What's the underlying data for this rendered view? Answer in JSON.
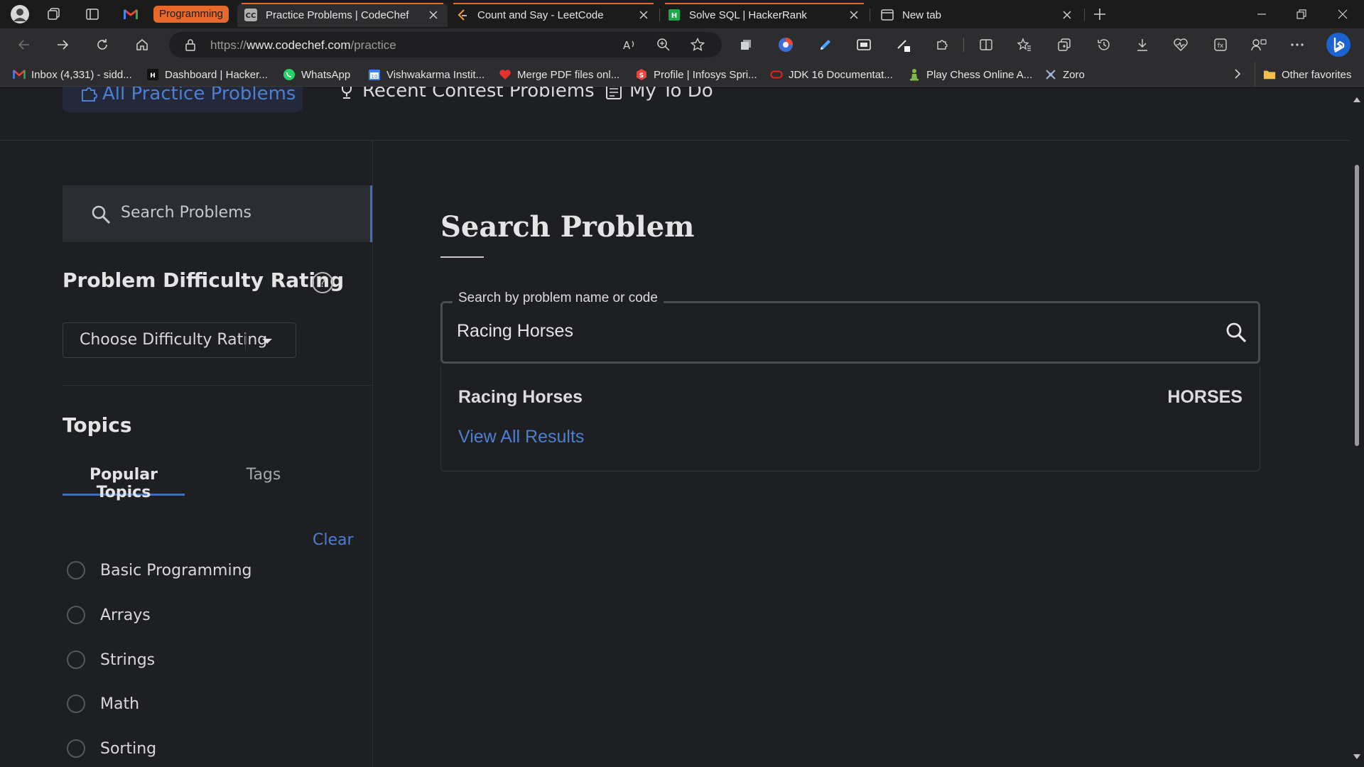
{
  "browser": {
    "tab_group_label": "Programming",
    "tabs": [
      {
        "title": "Practice Problems | CodeChef",
        "icon": "codechef-icon",
        "active": true
      },
      {
        "title": "Count and Say - LeetCode",
        "icon": "leetcode-icon",
        "active": false
      },
      {
        "title": "Solve SQL | HackerRank",
        "icon": "hackerrank-icon",
        "active": false
      },
      {
        "title": "New tab",
        "icon": "new-tab-icon",
        "active": false
      }
    ],
    "url_prefix": "https://",
    "url_host": "www.codechef.com",
    "url_path": "/practice",
    "favorites": [
      {
        "label": "Inbox (4,331) - sidd...",
        "icon": "gmail-icon"
      },
      {
        "label": "Dashboard | Hacker...",
        "icon": "hackerrank-icon"
      },
      {
        "label": "WhatsApp",
        "icon": "whatsapp-icon"
      },
      {
        "label": "Vishwakarma Instit...",
        "icon": "calendar-icon"
      },
      {
        "label": "Merge PDF files onl...",
        "icon": "heart-icon"
      },
      {
        "label": "Profile | Infosys Spri...",
        "icon": "infosys-icon"
      },
      {
        "label": "JDK 16 Documentat...",
        "icon": "oracle-icon"
      },
      {
        "label": "Play Chess Online A...",
        "icon": "chess-pawn-icon"
      },
      {
        "label": "Zoro",
        "icon": "zoro-icon"
      }
    ],
    "other_favorites_label": "Other favorites"
  },
  "page": {
    "top_nav": {
      "all_practice": "All Practice Problems",
      "recent_contest": "Recent Contest Problems",
      "todo": "My To Do"
    },
    "sidebar": {
      "search_placeholder": "Search Problems",
      "difficulty_title": "Problem Difficulty Rating",
      "difficulty_select": "Choose Difficulty Rating",
      "topics_title": "Topics",
      "tab_popular": "Popular Topics",
      "tab_tags": "Tags",
      "clear_label": "Clear",
      "topics": [
        "Basic Programming",
        "Arrays",
        "Strings",
        "Math",
        "Sorting"
      ]
    },
    "main": {
      "title": "Search Problem",
      "search_legend": "Search by problem name or code",
      "search_value": "Racing Horses",
      "result": {
        "name": "Racing Horses",
        "code": "HORSES"
      },
      "view_all": "View All Results"
    }
  },
  "colors": {
    "accent_blue": "#4d7fd0",
    "tab_group_orange": "#e8682a",
    "page_bg": "#1e1f22"
  }
}
